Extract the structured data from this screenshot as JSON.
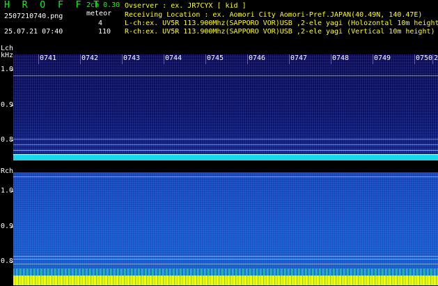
{
  "header": {
    "app_title": "H R O F F T",
    "version": "2ch 0.30",
    "filename": "2507210740.png",
    "meteor_label": "meteor",
    "meteor_count_lch": "4",
    "meteor_count_rch": "110",
    "datetime": "25.07.21 07:40",
    "info": [
      "Ovserver              : ex. JR7CYX [ kid ]",
      "Receiving Location : ex. Aomori City Aomori-Pref.JAPAN(40.49N, 140.47E)",
      "L-ch:ex. UV5R 113.900Mhz(SAPPORO VOR)USB ,2-ele yagi (Holozontal 10m height)",
      "R-ch:ex. UV5R 113.900Mhz(SAPPORO VOR)USB ,2-ele yagi (Vertical 10m height)"
    ]
  },
  "lch": {
    "label": "Lch",
    "unit": "kHz",
    "yticks": [
      "1.0",
      "0.9",
      "0.8"
    ]
  },
  "rch": {
    "label": "Rch",
    "yticks": [
      "1.0",
      "0.9",
      "0.8"
    ]
  },
  "time_ticks": [
    "0741",
    "0742",
    "0743",
    "0744",
    "0745",
    "0746",
    "0747",
    "0748",
    "0749",
    "0750",
    "2"
  ],
  "colors": {
    "green": "#00ff00",
    "yellow": "#ffff00",
    "cyan": "#00ffff",
    "white": "#ffffff",
    "lch_bg": "#0a1168",
    "rch_bg": "#1c4fc8"
  }
}
